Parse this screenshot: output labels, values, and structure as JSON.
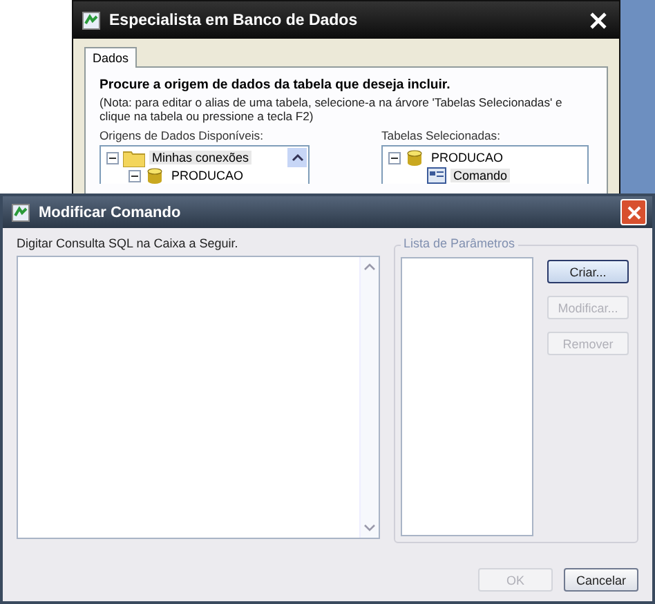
{
  "back_window": {
    "title": "Especialista em Banco de Dados",
    "tabs": [
      {
        "label": "Dados",
        "selected": true
      }
    ],
    "heading": "Procure a origem de dados da tabela que deseja incluir.",
    "note": "(Nota: para editar o alias de uma tabela, selecione-a na árvore 'Tabelas Selecionadas' e clique na tabela ou pressione a tecla F2)",
    "sources": {
      "label": "Origens de Dados Disponíveis:",
      "items": [
        {
          "label": "Minhas conexões",
          "kind": "folder",
          "expanded": true,
          "selected": true,
          "children": [
            {
              "label": "PRODUCAO",
              "kind": "database",
              "expanded": true,
              "selected": false
            }
          ]
        }
      ]
    },
    "selected_tables": {
      "label": "Tabelas Selecionadas:",
      "items": [
        {
          "label": "PRODUCAO",
          "kind": "database",
          "expanded": true,
          "selected": false,
          "children": [
            {
              "label": "Comando",
              "kind": "command",
              "selected": true
            }
          ]
        }
      ]
    }
  },
  "dialog": {
    "title": "Modificar Comando",
    "sql_label": "Digitar Consulta SQL na Caixa a Seguir.",
    "parameters_group": "Lista de Parâmetros",
    "side_buttons": [
      {
        "label": "Criar...",
        "disabled": false
      },
      {
        "label": "Modificar...",
        "disabled": true
      },
      {
        "label": "Remover",
        "disabled": true
      }
    ],
    "buttons": [
      {
        "label": "OK",
        "disabled": true
      },
      {
        "label": "Cancelar",
        "disabled": false
      }
    ]
  }
}
